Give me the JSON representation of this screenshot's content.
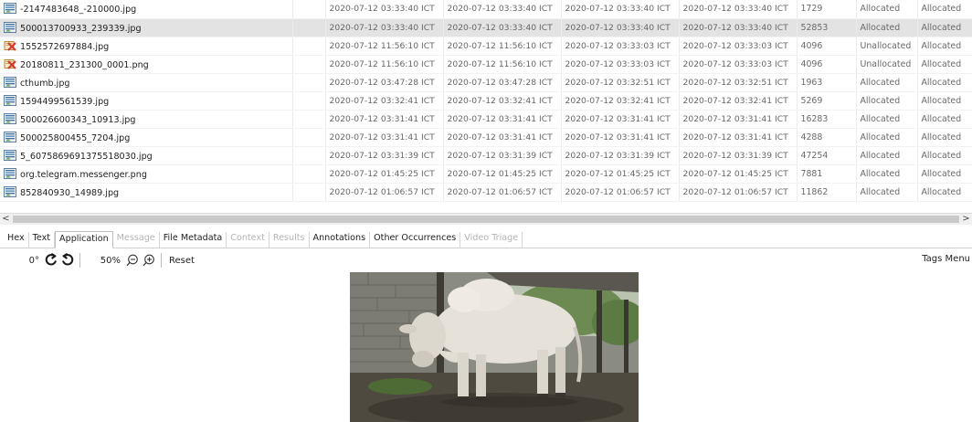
{
  "files": [
    {
      "name": "-2147483648_-210000.jpg",
      "icon": "image-file-icon",
      "modified": "2020-07-12 03:33:40 ICT",
      "changed": "2020-07-12 03:33:40 ICT",
      "accessed": "2020-07-12 03:33:40 ICT",
      "created": "2020-07-12 03:33:40 ICT",
      "size": "1729",
      "flags_dir": "Allocated",
      "flags_meta": "Allocated"
    },
    {
      "name": "500013700933_239339.jpg",
      "icon": "image-file-icon",
      "modified": "2020-07-12 03:33:40 ICT",
      "changed": "2020-07-12 03:33:40 ICT",
      "accessed": "2020-07-12 03:33:40 ICT",
      "created": "2020-07-12 03:33:40 ICT",
      "size": "52853",
      "flags_dir": "Allocated",
      "flags_meta": "Allocated"
    },
    {
      "name": "1552572697884.jpg",
      "icon": "deleted-file-icon",
      "modified": "2020-07-12 11:56:10 ICT",
      "changed": "2020-07-12 11:56:10 ICT",
      "accessed": "2020-07-12 03:33:03 ICT",
      "created": "2020-07-12 03:33:03 ICT",
      "size": "4096",
      "flags_dir": "Unallocated",
      "flags_meta": "Allocated"
    },
    {
      "name": "20180811_231300_0001.png",
      "icon": "deleted-file-icon",
      "modified": "2020-07-12 11:56:10 ICT",
      "changed": "2020-07-12 11:56:10 ICT",
      "accessed": "2020-07-12 03:33:03 ICT",
      "created": "2020-07-12 03:33:03 ICT",
      "size": "4096",
      "flags_dir": "Unallocated",
      "flags_meta": "Allocated"
    },
    {
      "name": "cthumb.jpg",
      "icon": "image-file-icon",
      "modified": "2020-07-12 03:47:28 ICT",
      "changed": "2020-07-12 03:47:28 ICT",
      "accessed": "2020-07-12 03:32:51 ICT",
      "created": "2020-07-12 03:32:51 ICT",
      "size": "1963",
      "flags_dir": "Allocated",
      "flags_meta": "Allocated"
    },
    {
      "name": "1594499561539.jpg",
      "icon": "image-file-icon",
      "modified": "2020-07-12 03:32:41 ICT",
      "changed": "2020-07-12 03:32:41 ICT",
      "accessed": "2020-07-12 03:32:41 ICT",
      "created": "2020-07-12 03:32:41 ICT",
      "size": "5269",
      "flags_dir": "Allocated",
      "flags_meta": "Allocated"
    },
    {
      "name": "500026600343_10913.jpg",
      "icon": "image-file-icon",
      "modified": "2020-07-12 03:31:41 ICT",
      "changed": "2020-07-12 03:31:41 ICT",
      "accessed": "2020-07-12 03:31:41 ICT",
      "created": "2020-07-12 03:31:41 ICT",
      "size": "16283",
      "flags_dir": "Allocated",
      "flags_meta": "Allocated"
    },
    {
      "name": "500025800455_7204.jpg",
      "icon": "image-file-icon",
      "modified": "2020-07-12 03:31:41 ICT",
      "changed": "2020-07-12 03:31:41 ICT",
      "accessed": "2020-07-12 03:31:41 ICT",
      "created": "2020-07-12 03:31:41 ICT",
      "size": "4288",
      "flags_dir": "Allocated",
      "flags_meta": "Allocated"
    },
    {
      "name": "5_6075869691375518030.jpg",
      "icon": "image-file-icon",
      "modified": "2020-07-12 03:31:39 ICT",
      "changed": "2020-07-12 03:31:39 ICT",
      "accessed": "2020-07-12 03:31:39 ICT",
      "created": "2020-07-12 03:31:39 ICT",
      "size": "47254",
      "flags_dir": "Allocated",
      "flags_meta": "Allocated"
    },
    {
      "name": "org.telegram.messenger.png",
      "icon": "image-file-icon",
      "modified": "2020-07-12 01:45:25 ICT",
      "changed": "2020-07-12 01:45:25 ICT",
      "accessed": "2020-07-12 01:45:25 ICT",
      "created": "2020-07-12 01:45:25 ICT",
      "size": "7881",
      "flags_dir": "Allocated",
      "flags_meta": "Allocated"
    },
    {
      "name": "852840930_14989.jpg",
      "icon": "image-file-icon",
      "modified": "2020-07-12 01:06:57 ICT",
      "changed": "2020-07-12 01:06:57 ICT",
      "accessed": "2020-07-12 01:06:57 ICT",
      "created": "2020-07-12 01:06:57 ICT",
      "size": "11862",
      "flags_dir": "Allocated",
      "flags_meta": "Allocated"
    }
  ],
  "selected_row": 1,
  "scrollbar": {
    "left_arrow": "<",
    "right_arrow": ">"
  },
  "tabs": [
    {
      "label": "Hex",
      "state": "enabled"
    },
    {
      "label": "Text",
      "state": "enabled"
    },
    {
      "label": "Application",
      "state": "active"
    },
    {
      "label": "Message",
      "state": "disabled"
    },
    {
      "label": "File Metadata",
      "state": "enabled"
    },
    {
      "label": "Context",
      "state": "disabled"
    },
    {
      "label": "Results",
      "state": "disabled"
    },
    {
      "label": "Annotations",
      "state": "enabled"
    },
    {
      "label": "Other Occurrences",
      "state": "enabled"
    },
    {
      "label": "Video Triage",
      "state": "disabled"
    }
  ],
  "viewer": {
    "rotation": "0°",
    "zoom": "50%",
    "reset_label": "Reset",
    "tags_menu_label": "Tags Menu"
  },
  "colors": {
    "selected_row": "#e3e3e3",
    "image_icon": "#4a7db0",
    "deleted_icon": "#d9534f"
  }
}
